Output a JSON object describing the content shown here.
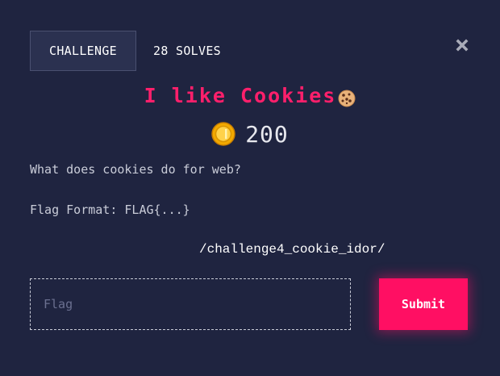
{
  "tabs": {
    "challenge_label": "CHALLENGE",
    "solves_label": "28 SOLVES"
  },
  "close_icon": "close-icon",
  "challenge": {
    "title": "I like Cookies",
    "title_emoji_icon": "cookie-icon",
    "points_icon": "coin-icon",
    "points": "200",
    "description_line1": "What does cookies do for web?",
    "description_line2": "Flag Format: FLAG{...}",
    "link_text": "/challenge4_cookie_idor/"
  },
  "form": {
    "flag_placeholder": "Flag",
    "flag_value": "",
    "submit_label": "Submit"
  },
  "colors": {
    "background": "#1f2440",
    "accent": "#ff0f63",
    "title": "#ff1f6b"
  }
}
